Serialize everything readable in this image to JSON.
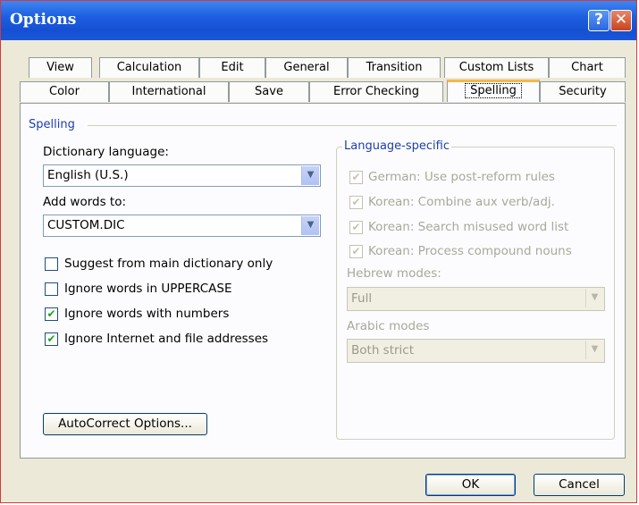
{
  "window": {
    "title": "Options",
    "help_label": "?",
    "close_label": "✕"
  },
  "tabs": {
    "row1": [
      "View",
      "Calculation",
      "Edit",
      "General",
      "Transition",
      "Custom Lists",
      "Chart"
    ],
    "row2": [
      "Color",
      "International",
      "Save",
      "Error Checking",
      "Spelling",
      "Security"
    ],
    "active": "Spelling"
  },
  "spelling": {
    "section_label": "Spelling",
    "dictionary_language_label": "Dictionary language:",
    "dictionary_language_value": "English (U.S.)",
    "add_words_label": "Add words to:",
    "add_words_value": "CUSTOM.DIC",
    "options": [
      {
        "label": "Suggest from main dictionary only",
        "checked": false
      },
      {
        "label": "Ignore words in UPPERCASE",
        "checked": false
      },
      {
        "label": "Ignore words with numbers",
        "checked": true
      },
      {
        "label": "Ignore Internet and file addresses",
        "checked": true
      }
    ],
    "autocorrect_button": "AutoCorrect Options..."
  },
  "language_specific": {
    "title": "Language-specific",
    "options": [
      {
        "label": "German: Use post-reform rules",
        "checked": true
      },
      {
        "label": "Korean: Combine aux verb/adj.",
        "checked": true
      },
      {
        "label": "Korean: Search misused word list",
        "checked": true
      },
      {
        "label": "Korean: Process compound nouns",
        "checked": true
      }
    ],
    "hebrew_label": "Hebrew modes:",
    "hebrew_value": "Full",
    "arabic_label": "Arabic modes",
    "arabic_value": "Both strict"
  },
  "footer": {
    "ok_label": "OK",
    "cancel_label": "Cancel"
  },
  "colors": {
    "titlebar": "#1c5fe0",
    "active_tab_accent": "#f7b74b",
    "check_mark": "#21a121",
    "group_title": "#1f3fa8"
  }
}
